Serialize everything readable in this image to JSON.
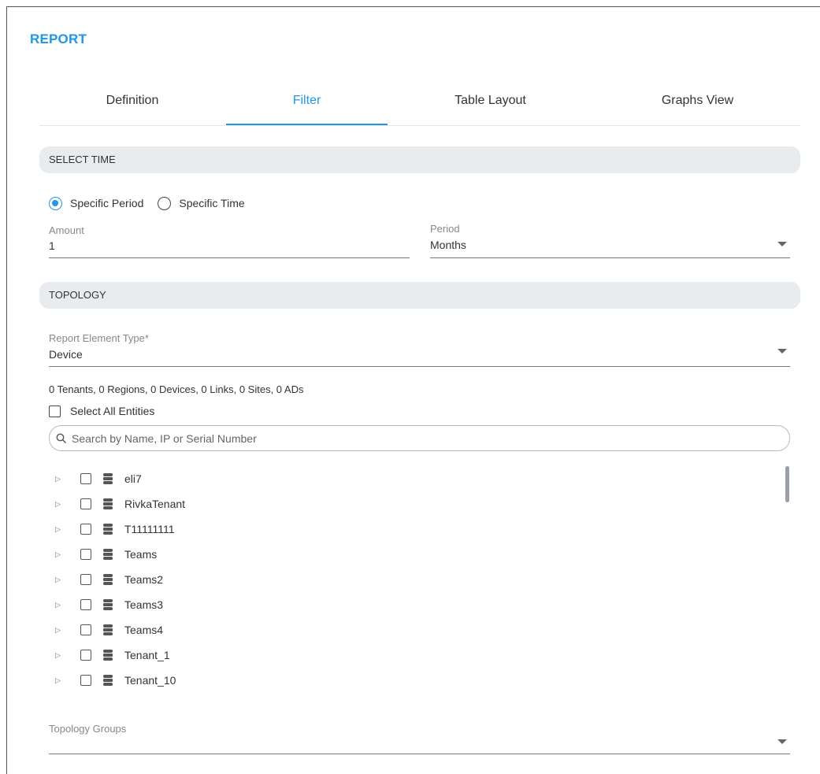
{
  "header": {
    "title": "REPORT"
  },
  "tabs": [
    {
      "label": "Definition",
      "active": false
    },
    {
      "label": "Filter",
      "active": true
    },
    {
      "label": "Table Layout",
      "active": false
    },
    {
      "label": "Graphs View",
      "active": false
    }
  ],
  "select_time": {
    "section_title": "SELECT TIME",
    "radio_specific_period": "Specific Period",
    "radio_specific_time": "Specific Time",
    "selected": "Specific Period",
    "amount_label": "Amount",
    "amount_value": "1",
    "period_label": "Period",
    "period_value": "Months"
  },
  "topology": {
    "section_title": "TOPOLOGY",
    "element_type_label": "Report Element Type*",
    "element_type_value": "Device",
    "counts_text": "0 Tenants, 0 Regions, 0 Devices, 0 Links, 0 Sites, 0 ADs",
    "select_all_label": "Select All Entities",
    "search_placeholder": "Search by Name, IP or Serial Number",
    "tree_items": [
      "eli7",
      "RivkaTenant",
      "T11111111",
      "Teams",
      "Teams2",
      "Teams3",
      "Teams4",
      "Tenant_1",
      "Tenant_10"
    ],
    "groups_label": "Topology Groups",
    "groups_value": ""
  },
  "colors": {
    "accent": "#2196e8",
    "section_bg": "#e9ecef"
  },
  "icons": {
    "tree_item": "database-icon",
    "search": "search-icon",
    "expand": "triangle-right-icon",
    "dropdown": "caret-down-icon"
  }
}
